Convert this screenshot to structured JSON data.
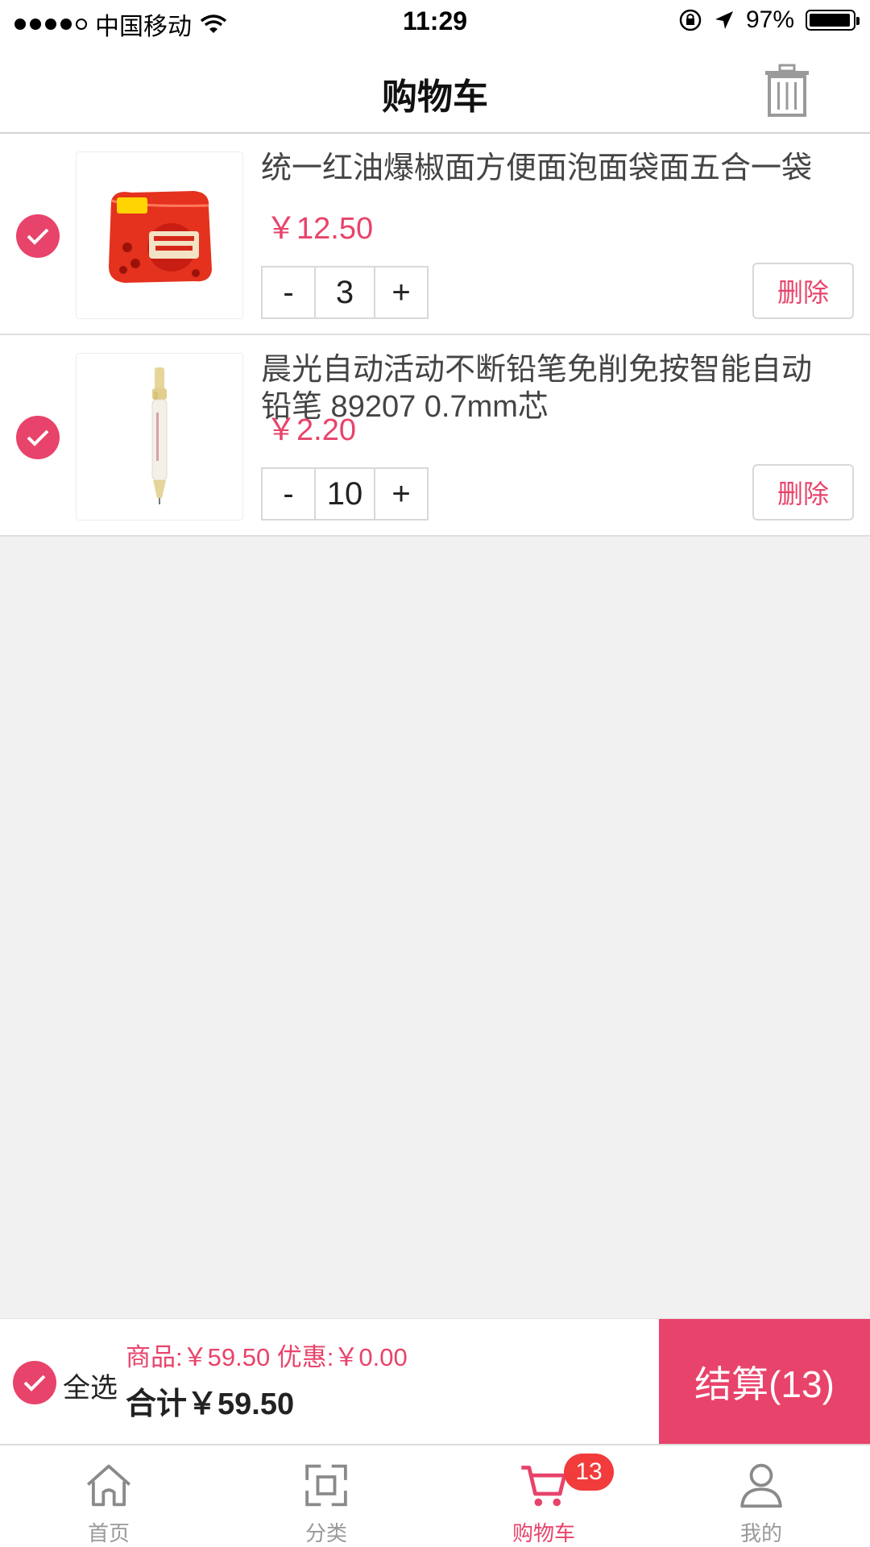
{
  "status_bar": {
    "carrier": "中国移动",
    "time": "11:29",
    "battery": "97%",
    "battery_level": 0.97,
    "signal_strength": "4 of 5"
  },
  "header": {
    "title": "购物车",
    "trash_icon": "trash-icon"
  },
  "cart": {
    "items": [
      {
        "name": "统一红油爆椒面方便面泡面袋面五合一袋",
        "price": "￥12.50",
        "quantity": "3",
        "minus_label": "-",
        "plus_label": "+",
        "delete_label": "删除",
        "image_icon": "instant-noodle-pack-image"
      },
      {
        "name": "晨光自动活动不断铅笔免削免按智能自动铅笔 89207 0.7mm芯",
        "price": "￥2.20",
        "quantity": "10",
        "minus_label": "-",
        "plus_label": "+",
        "delete_label": "删除",
        "image_icon": "mechanical-pencil-image"
      }
    ]
  },
  "checkout": {
    "select_all_label": "全选",
    "summary": "商品:￥59.50 优惠:￥0.00",
    "total": "合计￥59.50",
    "checkout_label": "结算(13)"
  },
  "tab_bar": {
    "tabs": [
      {
        "label": "首页",
        "icon": "home-icon"
      },
      {
        "label": "分类",
        "icon": "category-icon"
      },
      {
        "label": "购物车",
        "icon": "cart-icon",
        "badge": "13",
        "active": true
      },
      {
        "label": "我的",
        "icon": "profile-icon"
      }
    ]
  },
  "colors": {
    "accent": "#e8436a",
    "badge": "#f23b3b",
    "background": "#f1f1f1"
  }
}
